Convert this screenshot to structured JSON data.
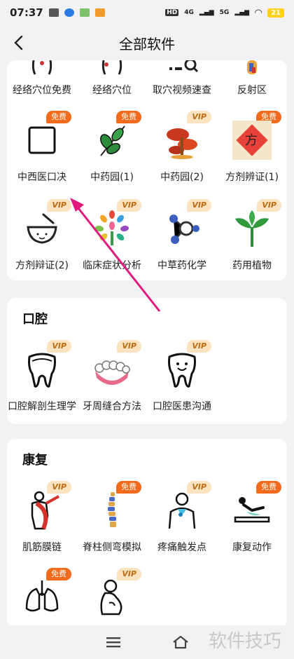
{
  "status_bar": {
    "time": "07:37",
    "network_left": "HD",
    "net1": "4G",
    "net2": "5G",
    "battery": "21"
  },
  "header": {
    "title": "全部软件"
  },
  "top_row": [
    {
      "label": "经络穴位免费",
      "icon": "acupoint-figure-icon"
    },
    {
      "label": "经络穴位",
      "icon": "acupoint-figure-icon"
    },
    {
      "label": "取穴视频速查",
      "icon": "video-search-icon"
    },
    {
      "label": "反射区",
      "icon": "foot-reflex-icon"
    }
  ],
  "section1": {
    "row1": [
      {
        "label": "中西医口决",
        "badge": "免费",
        "icon": "square-icon"
      },
      {
        "label": "中药园(1)",
        "badge": "免费",
        "icon": "herb-leaf-icon"
      },
      {
        "label": "中药园(2)",
        "badge": "VIP",
        "icon": "mushroom-icon"
      },
      {
        "label": "方剂辨证(1)",
        "badge": "免费",
        "icon": "fang-seal-icon",
        "glyph": "方"
      }
    ],
    "row2": [
      {
        "label": "方剂辩证(2)",
        "badge": "VIP",
        "icon": "mortar-icon"
      },
      {
        "label": "临床症状分析",
        "badge": "VIP",
        "icon": "colorful-tree-icon"
      },
      {
        "label": "中草药化学",
        "badge": "VIP",
        "icon": "molecule-icon"
      },
      {
        "label": "药用植物",
        "badge": "VIP",
        "icon": "plant-sprout-icon"
      }
    ]
  },
  "section2": {
    "title": "口腔",
    "items": [
      {
        "label": "口腔解剖生理学",
        "badge": "VIP",
        "icon": "tooth-icon"
      },
      {
        "label": "牙周缝合方法",
        "badge": "VIP",
        "icon": "dentures-icon"
      },
      {
        "label": "口腔医患沟通",
        "badge": "VIP",
        "icon": "smiling-tooth-icon"
      }
    ]
  },
  "section3": {
    "title": "康复",
    "row1": [
      {
        "label": "肌筋膜链",
        "badge": "VIP",
        "icon": "muscle-chain-icon"
      },
      {
        "label": "脊柱侧弯模拟",
        "badge": "免费",
        "icon": "spine-icon"
      },
      {
        "label": "疼痛触发点",
        "badge": "VIP",
        "icon": "pain-body-icon"
      },
      {
        "label": "康复动作",
        "badge": "免费",
        "icon": "exercise-icon"
      }
    ],
    "row2": [
      {
        "badge": "免费",
        "icon": "lungs-icon"
      },
      {
        "badge": "VIP",
        "icon": "pregnancy-icon"
      }
    ]
  },
  "watermark": "软件技巧",
  "colors": {
    "free_badge": "#f26a1b",
    "vip_badge_bg": "#fbe3bf",
    "arrow": "#e0197d"
  }
}
